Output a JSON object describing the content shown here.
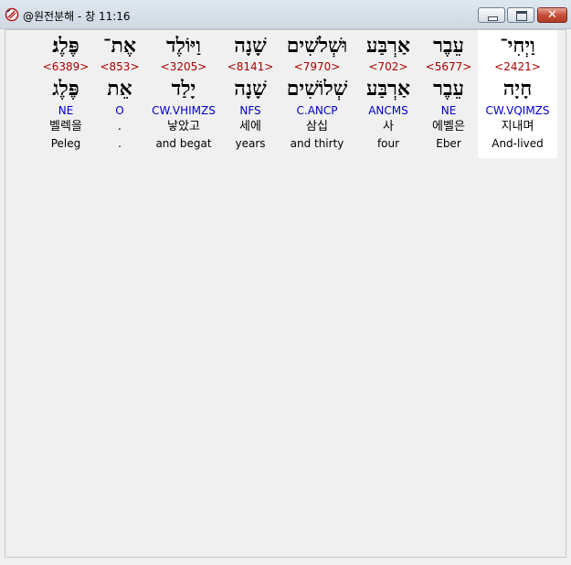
{
  "window": {
    "title": "@원전분해 - 창 11:16",
    "close_glyph": "✕"
  },
  "words": [
    {
      "hebrew": "פֶּלֶג׃",
      "strong": "<6389>",
      "lemma": "פֶּלֶג",
      "morph": "NE",
      "korean": "벨렉을",
      "english": "Peleg"
    },
    {
      "hebrew": "אֶת־",
      "strong": "<853>",
      "lemma": "אֵת",
      "morph": "O",
      "korean": ".",
      "english": "."
    },
    {
      "hebrew": "וַיּוֹלֶד",
      "strong": "<3205>",
      "lemma": "יָלַד",
      "morph": "CW.VHIMZS",
      "korean": "낳았고",
      "english": "and begat"
    },
    {
      "hebrew": "שָׁנָה",
      "strong": "<8141>",
      "lemma": "שָׁנָה",
      "morph": "NFS",
      "korean": "세에",
      "english": "years"
    },
    {
      "hebrew": "וּשְׁלֹשִׁים",
      "strong": "<7970>",
      "lemma": "שְׁלוֹשִׁים",
      "morph": "C.ANCP",
      "korean": "삼십",
      "english": "and thirty"
    },
    {
      "hebrew": "אַרְבַּע",
      "strong": "<702>",
      "lemma": "אַרְבַּע",
      "morph": "ANCMS",
      "korean": "사",
      "english": "four"
    },
    {
      "hebrew": "עֵבֶר",
      "strong": "<5677>",
      "lemma": "עֵבֶר",
      "morph": "NE",
      "korean": "에벨은",
      "english": "Eber"
    },
    {
      "hebrew": "וַיְחִי־",
      "strong": "<2421>",
      "lemma": "חָיָה",
      "morph": "CW.VQIMZS",
      "korean": "지내며",
      "english": "And-lived"
    }
  ],
  "colors": {
    "strong_number": "#aa0000",
    "morphology": "#0000cc",
    "selected_background": "#ffffff"
  }
}
